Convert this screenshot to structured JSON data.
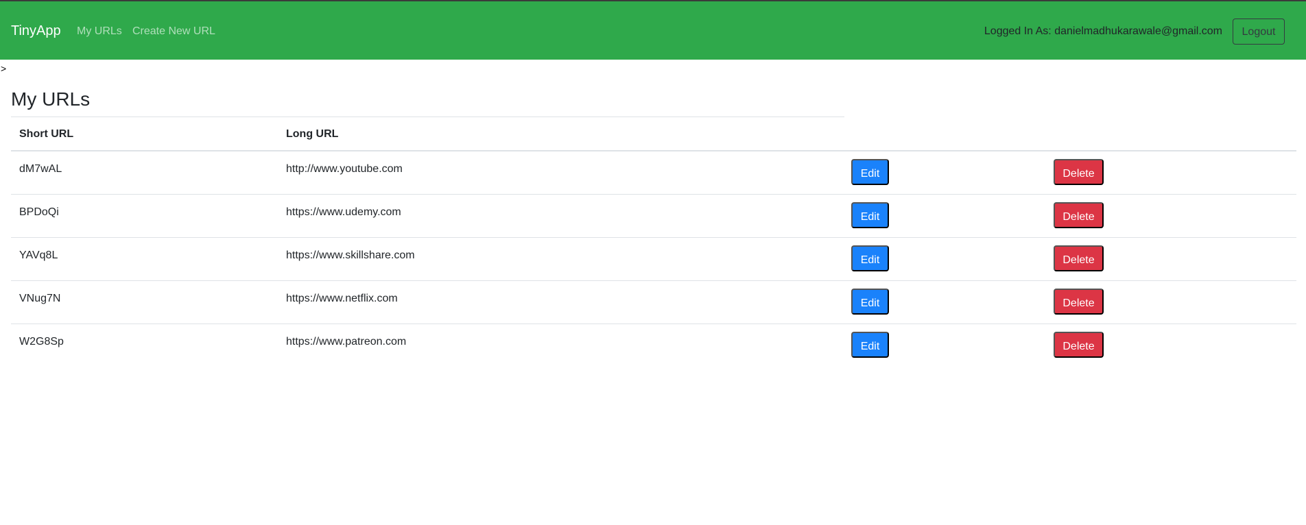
{
  "navbar": {
    "brand": "TinyApp",
    "links": [
      "My URLs",
      "Create New URL"
    ],
    "logged_in_text": "Logged In As: danielmadhukarawale@gmail.com",
    "logout_label": "Logout",
    "background_color": "#2fa94b"
  },
  "stray_text": ">",
  "page": {
    "title": "My URLs"
  },
  "table": {
    "columns": [
      "Short URL",
      "Long URL"
    ],
    "edit_label": "Edit",
    "delete_label": "Delete",
    "rows": [
      {
        "short": "dM7wAL",
        "long": "http://www.youtube.com"
      },
      {
        "short": "BPDoQi",
        "long": "https://www.udemy.com"
      },
      {
        "short": "YAVq8L",
        "long": "https://www.skillshare.com"
      },
      {
        "short": "VNug7N",
        "long": "https://www.netflix.com"
      },
      {
        "short": "W2G8Sp",
        "long": "https://www.patreon.com"
      }
    ]
  },
  "colors": {
    "edit_button": "#1a82fb",
    "delete_button": "#dc3545"
  }
}
